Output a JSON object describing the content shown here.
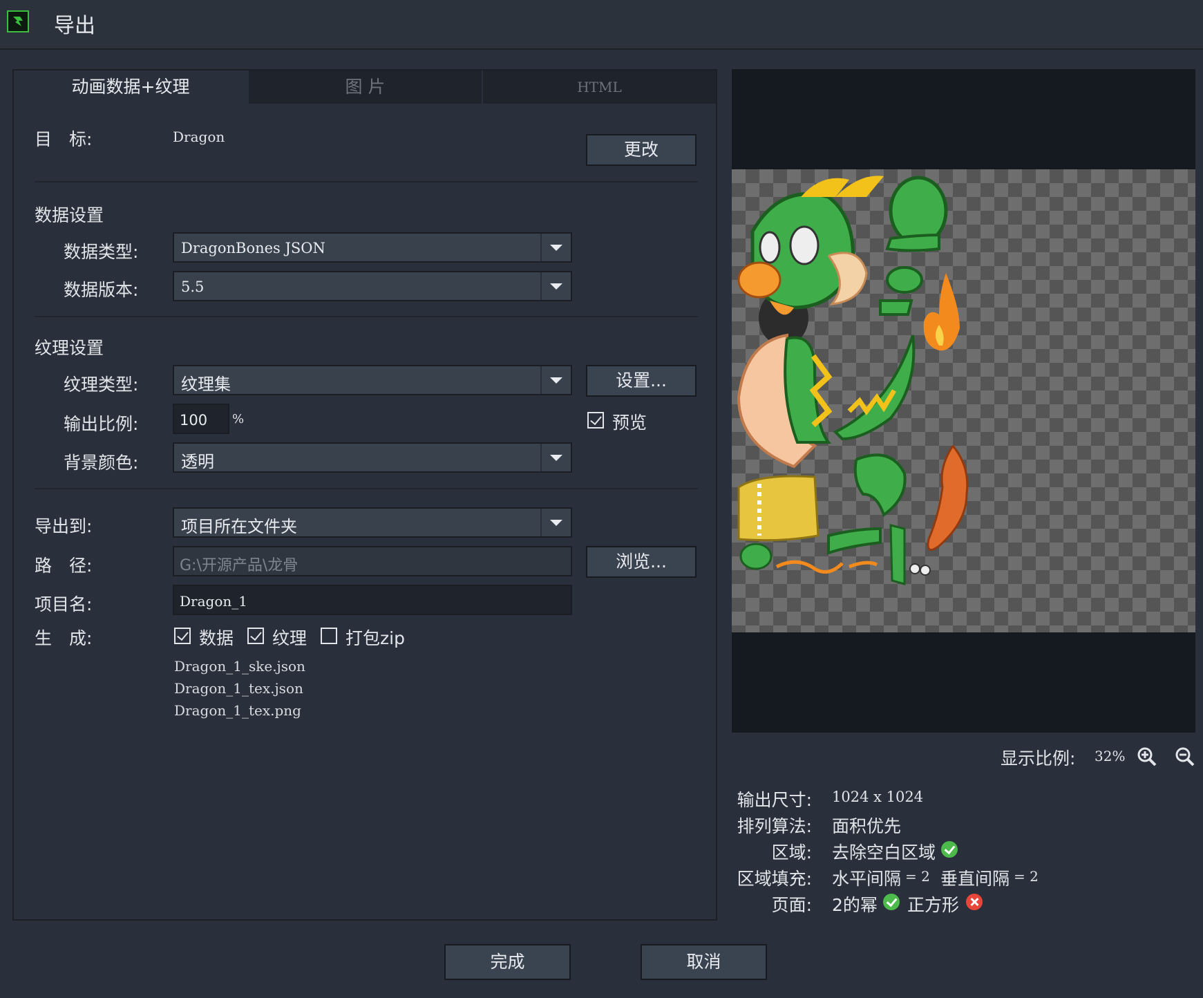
{
  "window": {
    "title": "导出",
    "logo_icon": "dragonbones-logo-icon"
  },
  "tabs": [
    {
      "label": "动画数据+纹理",
      "active": true
    },
    {
      "label": "图 片",
      "active": false
    },
    {
      "label": "HTML",
      "active": false
    }
  ],
  "target": {
    "label": "目　标:",
    "value": "Dragon",
    "change_button": "更改"
  },
  "data_settings": {
    "heading": "数据设置",
    "type_label": "数据类型:",
    "type_value": "DragonBones JSON",
    "version_label": "数据版本:",
    "version_value": "5.5"
  },
  "texture_settings": {
    "heading": "纹理设置",
    "type_label": "纹理类型:",
    "type_value": "纹理集",
    "settings_button": "设置...",
    "scale_label": "输出比例:",
    "scale_value": "100",
    "scale_unit": "%",
    "preview_label": "预览",
    "preview_checked": true,
    "bg_label": "背景颜色:",
    "bg_value": "透明"
  },
  "output": {
    "export_to_label": "导出到:",
    "export_to_value": "项目所在文件夹",
    "path_label": "路　径:",
    "path_value": "G:\\开源产品\\龙骨",
    "browse_button": "浏览...",
    "project_name_label": "项目名:",
    "project_name_value": "Dragon_1",
    "generate_label": "生　成:",
    "generate_options": [
      {
        "label": "数据",
        "checked": true
      },
      {
        "label": "纹理",
        "checked": true
      },
      {
        "label": "打包zip",
        "checked": false
      }
    ],
    "files": [
      "Dragon_1_ske.json",
      "Dragon_1_tex.json",
      "Dragon_1_tex.png"
    ]
  },
  "preview": {
    "zoom_label": "显示比例:",
    "zoom_value": "32%",
    "zoom_in_icon": "zoom-in-icon",
    "zoom_out_icon": "zoom-out-icon"
  },
  "info": {
    "size_label": "输出尺寸:",
    "size_value": "1024 x 1024",
    "algo_label": "排列算法:",
    "algo_value": "面积优先",
    "region_label": "区域:",
    "region_value": "去除空白区域",
    "padding_label": "区域填充:",
    "padding_h": "水平间隔",
    "padding_h_value": "= 2",
    "padding_v": "垂直间隔",
    "padding_v_value": "= 2",
    "page_label": "页面:",
    "page_pow2": "2的幂",
    "page_square": "正方形"
  },
  "footer": {
    "done_button": "完成",
    "cancel_button": "取消"
  },
  "colors": {
    "background": "#2a303b",
    "ok": "#4cbb4c",
    "error": "#e8463a",
    "dragon_green": "#3fae4a"
  }
}
